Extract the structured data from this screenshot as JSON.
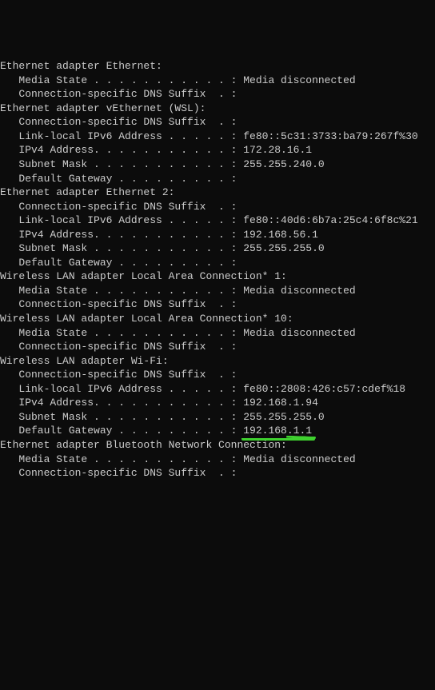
{
  "sections": [
    {
      "heading": "Ethernet adapter Ethernet:",
      "rows": [
        {
          "label": "Media State . . . . . . . . . . . :",
          "value": "Media disconnected"
        },
        {
          "label": "Connection-specific DNS Suffix  . :",
          "value": ""
        }
      ]
    },
    {
      "heading": "Ethernet adapter vEthernet (WSL):",
      "rows": [
        {
          "label": "Connection-specific DNS Suffix  . :",
          "value": ""
        },
        {
          "label": "Link-local IPv6 Address . . . . . :",
          "value": "fe80::5c31:3733:ba79:267f%30"
        },
        {
          "label": "IPv4 Address. . . . . . . . . . . :",
          "value": "172.28.16.1"
        },
        {
          "label": "Subnet Mask . . . . . . . . . . . :",
          "value": "255.255.240.0"
        },
        {
          "label": "Default Gateway . . . . . . . . . :",
          "value": ""
        }
      ]
    },
    {
      "heading": "Ethernet adapter Ethernet 2:",
      "rows": [
        {
          "label": "Connection-specific DNS Suffix  . :",
          "value": ""
        },
        {
          "label": "Link-local IPv6 Address . . . . . :",
          "value": "fe80::40d6:6b7a:25c4:6f8c%21"
        },
        {
          "label": "IPv4 Address. . . . . . . . . . . :",
          "value": "192.168.56.1"
        },
        {
          "label": "Subnet Mask . . . . . . . . . . . :",
          "value": "255.255.255.0"
        },
        {
          "label": "Default Gateway . . . . . . . . . :",
          "value": ""
        }
      ]
    },
    {
      "heading": "Wireless LAN adapter Local Area Connection* 1:",
      "rows": [
        {
          "label": "Media State . . . . . . . . . . . :",
          "value": "Media disconnected"
        },
        {
          "label": "Connection-specific DNS Suffix  . :",
          "value": ""
        }
      ]
    },
    {
      "heading": "Wireless LAN adapter Local Area Connection* 10:",
      "rows": [
        {
          "label": "Media State . . . . . . . . . . . :",
          "value": "Media disconnected"
        },
        {
          "label": "Connection-specific DNS Suffix  . :",
          "value": ""
        }
      ]
    },
    {
      "heading": "Wireless LAN adapter Wi-Fi:",
      "rows": [
        {
          "label": "Connection-specific DNS Suffix  . :",
          "value": ""
        },
        {
          "label": "Link-local IPv6 Address . . . . . :",
          "value": "fe80::2808:426:c57:cdef%18"
        },
        {
          "label": "IPv4 Address. . . . . . . . . . . :",
          "value": "192.168.1.94"
        },
        {
          "label": "Subnet Mask . . . . . . . . . . . :",
          "value": "255.255.255.0"
        },
        {
          "label": "Default Gateway . . . . . . . . . :",
          "value": "192.168.1.1",
          "highlight": true
        }
      ]
    },
    {
      "heading": "Ethernet adapter Bluetooth Network Connection:",
      "rows": [
        {
          "label": "Media State . . . . . . . . . . . :",
          "value": "Media disconnected"
        },
        {
          "label": "Connection-specific DNS Suffix  . :",
          "value": ""
        }
      ]
    }
  ],
  "annotation": {
    "color": "#3fd12f",
    "target": "192.168.1.1"
  }
}
